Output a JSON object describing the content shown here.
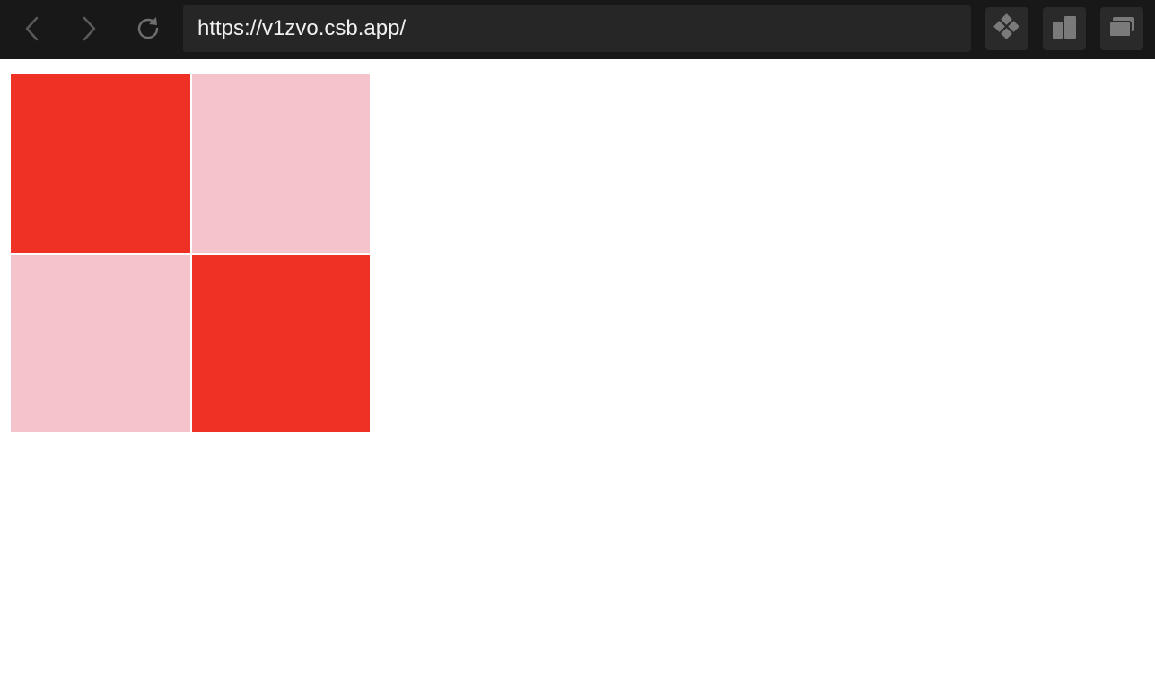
{
  "browser": {
    "url": "https://v1zvo.csb.app/",
    "icons": {
      "back": "chevron-left-icon",
      "forward": "chevron-right-icon",
      "reload": "reload-icon",
      "tool1": "codesandbox-diamond-icon",
      "tool2": "split-view-icon",
      "tool3": "windows-icon"
    }
  },
  "page": {
    "cells": [
      {
        "color": "#ee3124"
      },
      {
        "color": "#f4c3cc"
      },
      {
        "color": "#f4c3cc"
      },
      {
        "color": "#ee3124"
      }
    ]
  }
}
